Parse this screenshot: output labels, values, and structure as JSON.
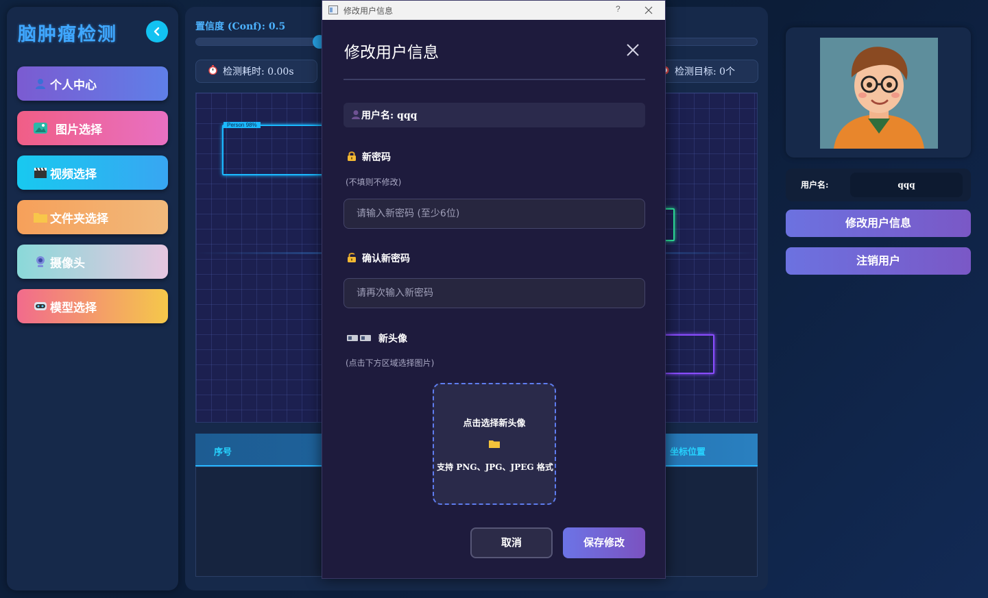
{
  "sidebar": {
    "app_title": "脑肿瘤检测",
    "items": [
      {
        "icon": "user-icon",
        "label": "个人中心"
      },
      {
        "icon": "image-icon",
        "label": "图片选择"
      },
      {
        "icon": "clapperboard-icon",
        "label": "视频选择"
      },
      {
        "icon": "folder-icon",
        "label": "文件夹选择"
      },
      {
        "icon": "webcam-icon",
        "label": "摄像头"
      },
      {
        "icon": "robot-icon",
        "label": "模型选择"
      }
    ]
  },
  "main": {
    "conf_label": "置信度 (Conf): 0.5",
    "conf_value": 0.5,
    "time_label": "检测耗时: 0.00s",
    "count_label": "检测目标: 0个",
    "detection_tag": "Person 98%",
    "table_headers": [
      "序号",
      "坐标位置"
    ]
  },
  "right": {
    "username_label": "用户名:",
    "username_value": "qqq",
    "edit_button": "修改用户信息",
    "logout_button": "注销用户"
  },
  "dialog": {
    "window_title": "修改用户信息",
    "help_glyph": "?",
    "heading": "修改用户信息",
    "username_line": "用户名: qqq",
    "new_password_label": "新密码",
    "new_password_hint": "(不填则不修改)",
    "new_password_placeholder": "请输入新密码 (至少6位)",
    "confirm_password_label": "确认新密码",
    "confirm_password_placeholder": "请再次输入新密码",
    "avatar_label": "新头像",
    "avatar_hint": "(点击下方区域选择图片)",
    "pick_title": "点击选择新头像",
    "pick_formats": "支持 PNG、JPG、JPEG 格式",
    "cancel_button": "取消",
    "save_button": "保存修改"
  },
  "colors": {
    "accent": "#3fa7ff",
    "dialog_bg": "#1e1b3d",
    "button_gradient_start": "#6c74e6",
    "button_gradient_end": "#7b52c0"
  }
}
